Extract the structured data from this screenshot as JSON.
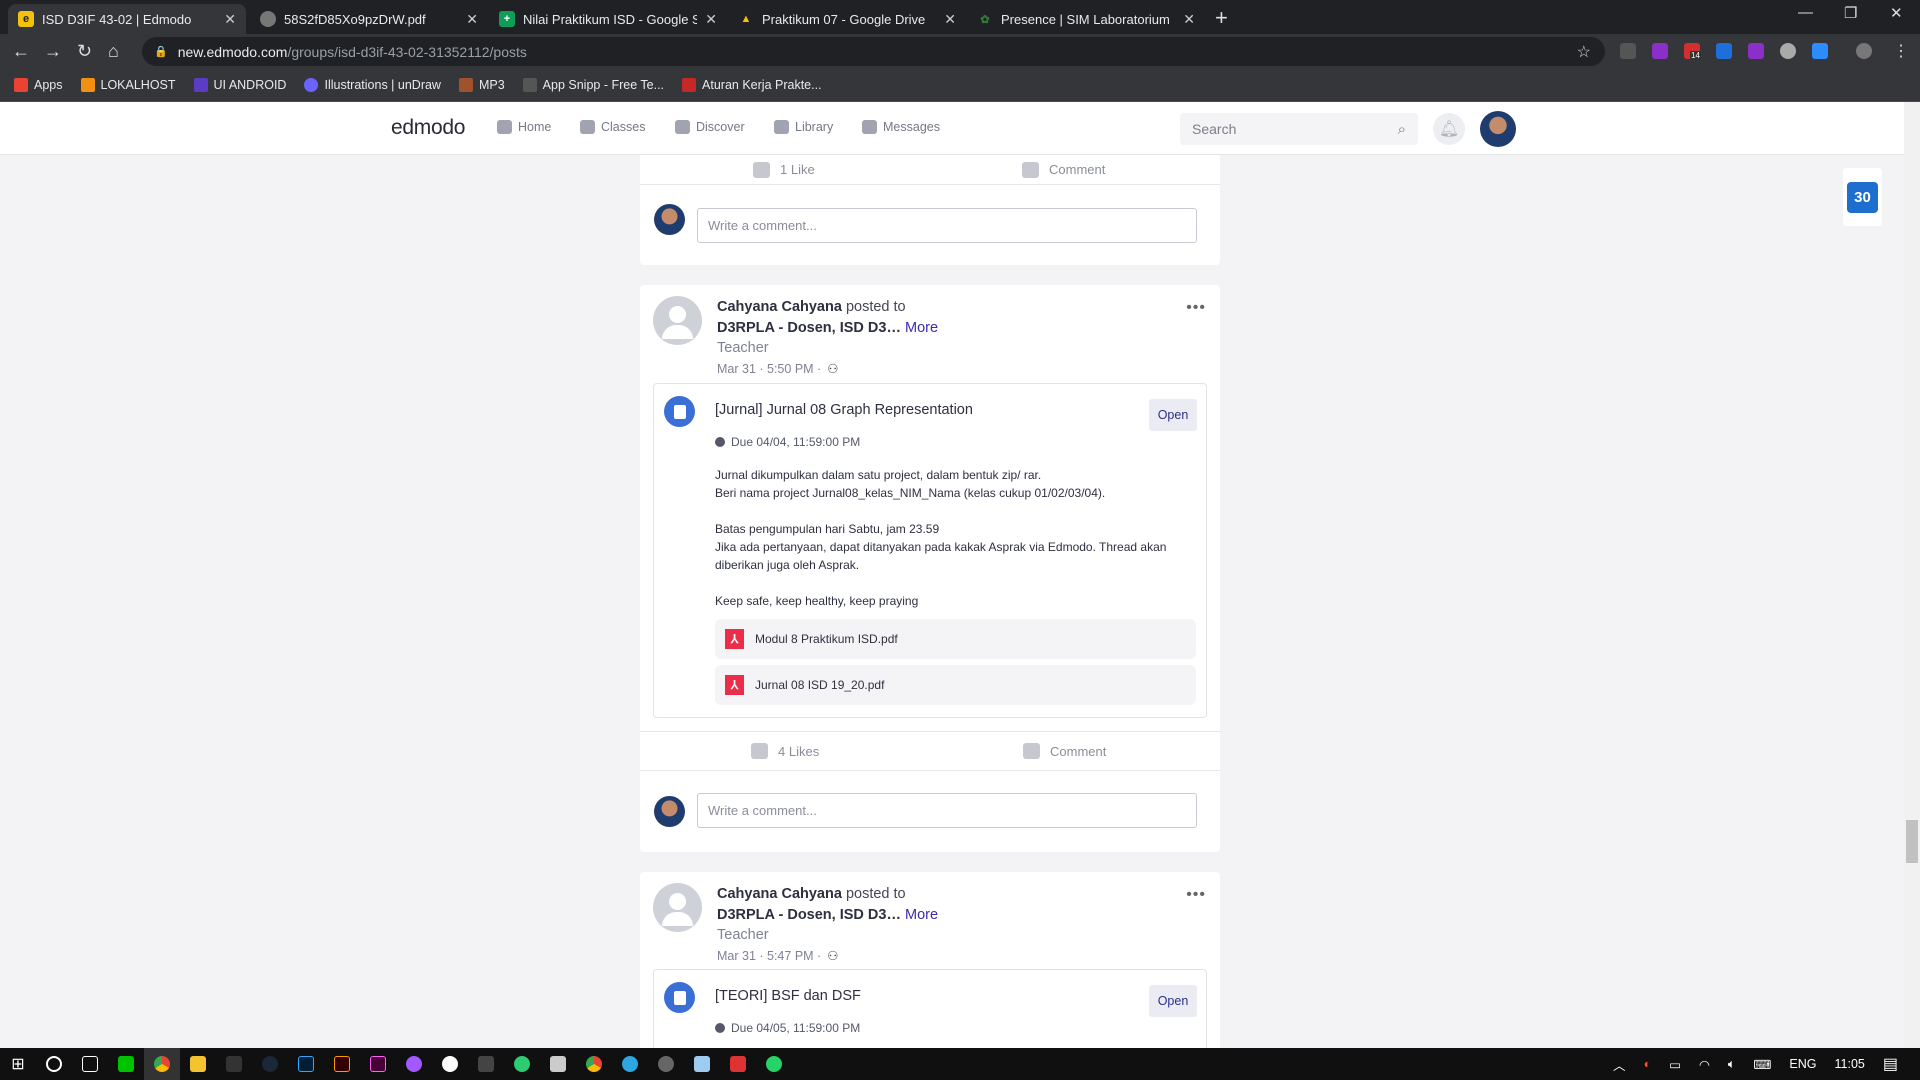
{
  "browser": {
    "tabs": [
      {
        "title": "ISD D3IF 43-02 | Edmodo",
        "active": true,
        "color": "#f4c20d",
        "glyph": "e"
      },
      {
        "title": "58S2fD85Xo9pzDrW.pdf",
        "active": false,
        "color": "#777",
        "glyph": ""
      },
      {
        "title": "Nilai Praktikum ISD - Google Spr",
        "active": false,
        "color": "#0f9d58",
        "glyph": "+"
      },
      {
        "title": "Praktikum 07 - Google Drive",
        "active": false,
        "color": "#fbbc04",
        "glyph": "▲"
      },
      {
        "title": "Presence | SIM Laboratorium",
        "active": false,
        "color": "#2e7d32",
        "glyph": "✿"
      }
    ],
    "url_host": "new.edmodo.com",
    "url_path": "/groups/isd-d3if-43-02-31352112/posts",
    "extension_badge": "14",
    "bookmarks": [
      {
        "label": "Apps",
        "color": "#ea4335"
      },
      {
        "label": "LOKALHOST",
        "color": "#f29111"
      },
      {
        "label": "UI ANDROID",
        "color": "#5b3cc4"
      },
      {
        "label": "Illustrations | unDraw",
        "color": "#6c63ff"
      },
      {
        "label": "MP3",
        "color": "#a0522d"
      },
      {
        "label": "App Snipp - Free Te...",
        "color": "#222"
      },
      {
        "label": "Aturan Kerja Prakte...",
        "color": "#c62828"
      }
    ]
  },
  "app": {
    "logo": "edmodo",
    "nav": [
      "Home",
      "Classes",
      "Discover",
      "Library",
      "Messages"
    ],
    "search_placeholder": "Search",
    "calendar_day": "30"
  },
  "feed": {
    "prev_post": {
      "likes": "1 Like",
      "comment": "Comment",
      "comment_placeholder": "Write a comment..."
    },
    "posts": [
      {
        "author": "Cahyana Cahyana",
        "posted_to": "posted to",
        "groups": "D3RPLA - Dosen,  ISD D3…",
        "more": "More",
        "role": "Teacher",
        "time": "Mar 31 · 5:50 PM ·",
        "assignment": {
          "title": "[Jurnal] Jurnal 08 Graph Representation",
          "open": "Open",
          "due": "Due 04/04, 11:59:00 PM",
          "body": [
            "Jurnal dikumpulkan dalam satu project, dalam bentuk zip/ rar.",
            "Beri nama project Jurnal08_kelas_NIM_Nama (kelas cukup 01/02/03/04).",
            "",
            "Batas pengumpulan hari Sabtu, jam 23.59",
            "Jika ada pertanyaan, dapat ditanyakan pada kakak Asprak via Edmodo. Thread akan diberikan juga oleh Asprak.",
            "",
            "Keep safe, keep healthy, keep praying"
          ],
          "files": [
            "Modul 8 Praktikum ISD.pdf",
            "Jurnal 08 ISD 19_20.pdf"
          ]
        },
        "likes": "4 Likes",
        "comment": "Comment",
        "comment_placeholder": "Write a comment..."
      },
      {
        "author": "Cahyana Cahyana",
        "posted_to": "posted to",
        "groups": "D3RPLA - Dosen,  ISD D3…",
        "more": "More",
        "role": "Teacher",
        "time": "Mar 31 · 5:47 PM ·",
        "assignment": {
          "title": "[TEORI] BSF dan DSF",
          "open": "Open",
          "due": "Due 04/05, 11:59:00 PM"
        }
      }
    ]
  },
  "taskbar": {
    "language": "ENG",
    "clock": "11:05"
  }
}
